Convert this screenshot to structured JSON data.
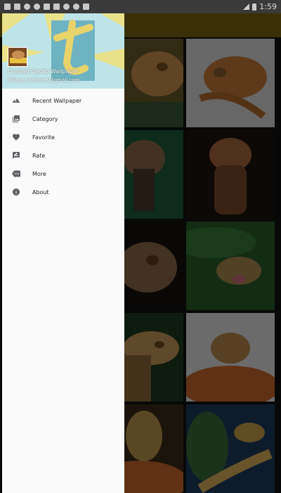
{
  "status_bar": {
    "time": "1:59",
    "icons": [
      "notification-icon",
      "notification-icon",
      "shield-icon",
      "globe-icon",
      "game-icon",
      "notification-icon",
      "instagram-icon",
      "instagram-icon",
      "play-icon"
    ]
  },
  "app_bar": {
    "color": "#7a6410"
  },
  "drawer": {
    "header": {
      "app_name": "Crested Gecko Wallpaper",
      "email": "billaya.sandones@gmail.com"
    },
    "menu": [
      {
        "label": "Recent Wallpaper",
        "icon": "landscape-icon"
      },
      {
        "label": "Category",
        "icon": "photo-library-icon"
      },
      {
        "label": "Favorite",
        "icon": "heart-icon"
      },
      {
        "label": "Rate",
        "icon": "rate-review-icon"
      },
      {
        "label": "More",
        "icon": "more-icon"
      },
      {
        "label": "About",
        "icon": "info-icon"
      }
    ]
  },
  "grid": {
    "tiles": [
      {
        "id": "gecko-1",
        "icon": "gecko-thumbnail"
      },
      {
        "id": "gecko-2",
        "icon": "gecko-thumbnail"
      },
      {
        "id": "gecko-3",
        "icon": "gecko-thumbnail"
      },
      {
        "id": "gecko-4",
        "icon": "gecko-thumbnail"
      },
      {
        "id": "gecko-5",
        "icon": "gecko-thumbnail"
      },
      {
        "id": "gecko-6",
        "icon": "gecko-thumbnail"
      },
      {
        "id": "gecko-7",
        "icon": "gecko-thumbnail"
      },
      {
        "id": "gecko-8",
        "icon": "gecko-thumbnail"
      },
      {
        "id": "gecko-9",
        "icon": "gecko-thumbnail"
      },
      {
        "id": "gecko-10",
        "icon": "gecko-thumbnail"
      }
    ]
  }
}
